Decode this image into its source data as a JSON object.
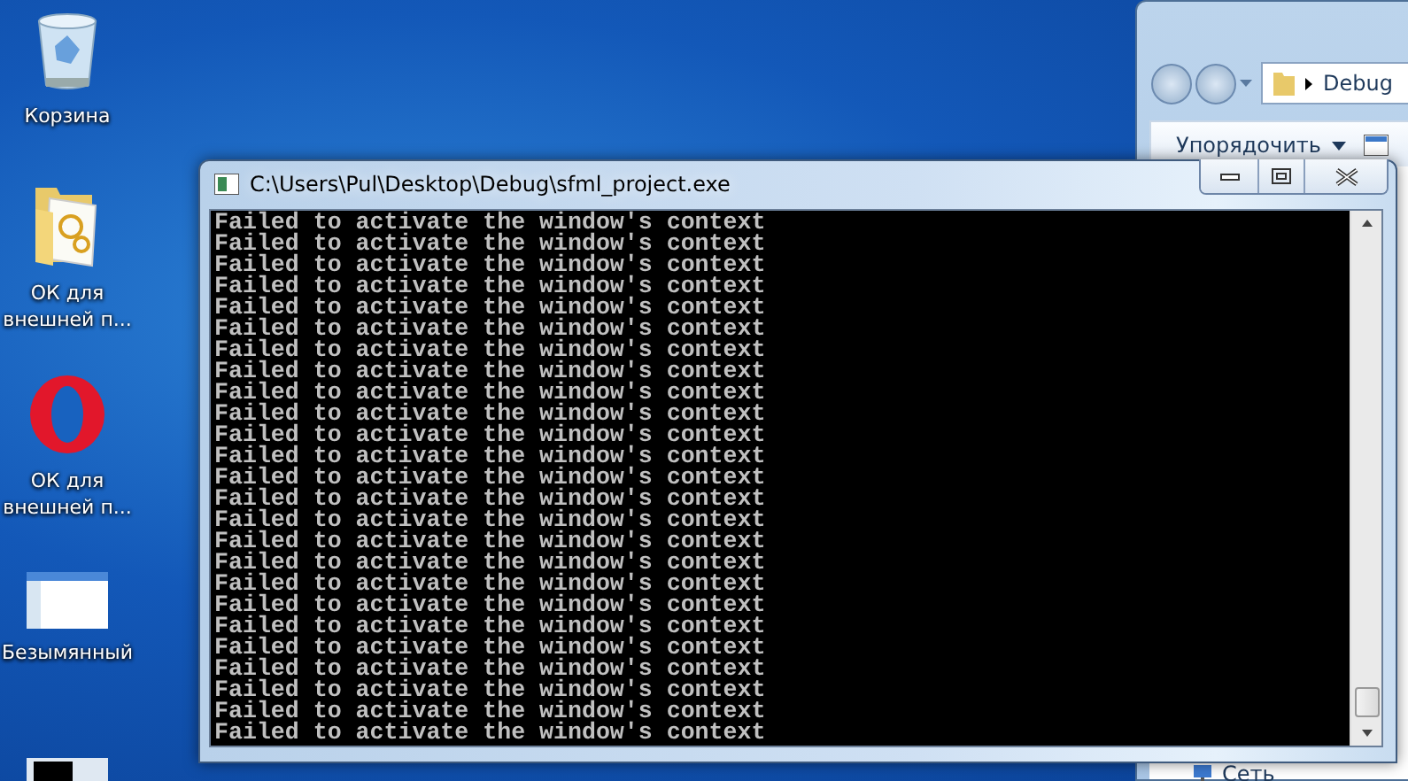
{
  "desktop_icons": [
    {
      "kind": "recycle-bin",
      "label": "Корзина"
    },
    {
      "kind": "folder",
      "label": "ОК для внешней п..."
    },
    {
      "kind": "opera",
      "label": "ОК для внешней п..."
    },
    {
      "kind": "thumbnail",
      "label": "Безымянный"
    },
    {
      "kind": "console-thumbnail"
    }
  ],
  "explorer": {
    "path": "Debug",
    "organize": "Упорядочить",
    "nav_item": "Сеть"
  },
  "console": {
    "title": "C:\\Users\\Pul\\Desktop\\Debug\\sfml_project.exe",
    "lines": [
      "Failed to activate the window's context",
      "Failed to activate the window's context",
      "Failed to activate the window's context",
      "Failed to activate the window's context",
      "Failed to activate the window's context",
      "Failed to activate the window's context",
      "Failed to activate the window's context",
      "Failed to activate the window's context",
      "Failed to activate the window's context",
      "Failed to activate the window's context",
      "Failed to activate the window's context",
      "Failed to activate the window's context",
      "Failed to activate the window's context",
      "Failed to activate the window's context",
      "Failed to activate the window's context",
      "Failed to activate the window's context",
      "Failed to activate the window's context",
      "Failed to activate the window's context",
      "Failed to activate the window's context",
      "Failed to activate the window's context",
      "Failed to activate the window's context",
      "Failed to activate the window's context",
      "Failed to activate the window's context",
      "Failed to activate the window's context",
      "Failed to activate the window's context"
    ]
  }
}
